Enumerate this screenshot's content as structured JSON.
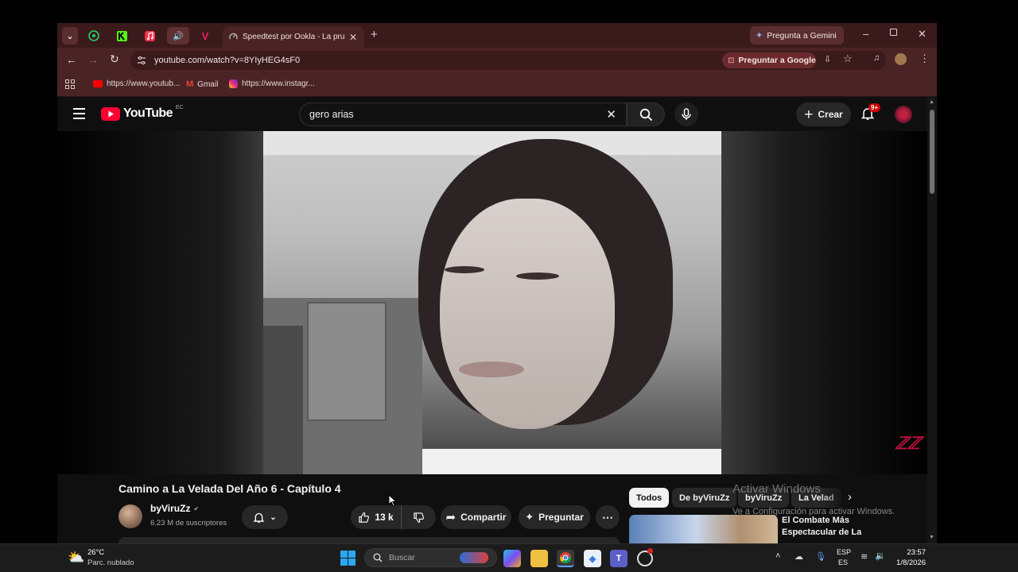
{
  "tabs": {
    "active_title": "Speedtest por Ookla - La prueb",
    "gemini_label": "Pregunta a Gemini"
  },
  "toolbar": {
    "url": "youtube.com/watch?v=8YIyHEG4sF0",
    "ask_google_label": "Preguntar a Google"
  },
  "bookmarks": [
    {
      "label": "https://www.youtub..."
    },
    {
      "label": "Gmail"
    },
    {
      "label": "https://www.instagr..."
    }
  ],
  "youtube": {
    "logo_text": "YouTube",
    "country_code": "EC",
    "search_value": "gero arias",
    "create_label": "Crear",
    "notif_badge": "9+",
    "watermark_icon": "viruzz-logo"
  },
  "video": {
    "title": "Camino a La Velada Del Año 6 - Capítulo 4",
    "channel_name": "byViruZz",
    "subscribers": "6.23 M de suscriptores",
    "likes": "13 k",
    "share_label": "Compartir",
    "ask_label": "Preguntar"
  },
  "chips": [
    "Todos",
    "De byViruZz",
    "byViruZz",
    "La Velad"
  ],
  "recommended": {
    "title": "El Combate Más Espectacular de La"
  },
  "activation": {
    "title": "Activar Windows",
    "subtitle": "Ve a Configuración para activar Windows."
  },
  "taskbar": {
    "temperature": "26°C",
    "weather": "Parc. nublado",
    "search_placeholder": "Buscar",
    "lang_top": "ESP",
    "lang_bottom": "ES",
    "time": "23:57",
    "date": "1/8/2026"
  },
  "colors": {
    "accent_red": "#ff0033",
    "tab_bg": "#3b1a1c",
    "toolbar_bg": "#4a2324"
  }
}
